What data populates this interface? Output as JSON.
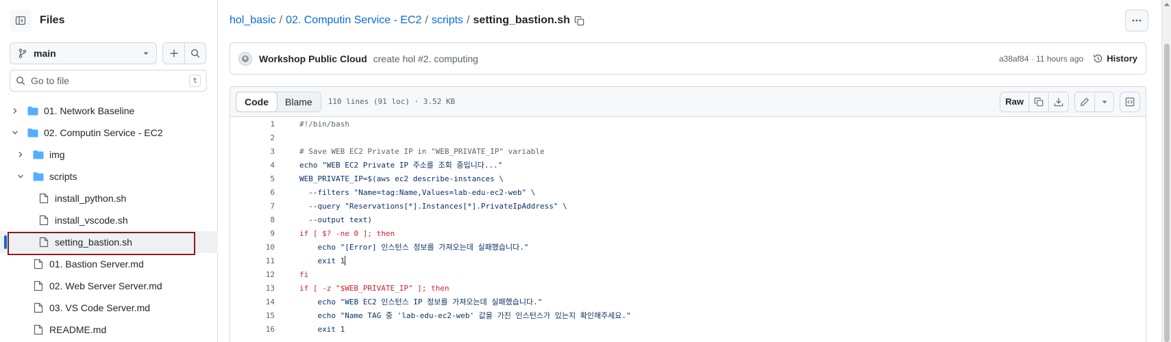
{
  "sidebar": {
    "title": "Files",
    "branch": "main",
    "goto_placeholder": "Go to file",
    "goto_shortcut": "t",
    "tree": [
      {
        "label": "01. Network Baseline",
        "kind": "folder",
        "expanded": false,
        "depth": 0
      },
      {
        "label": "02. Computin Service - EC2",
        "kind": "folder",
        "expanded": true,
        "depth": 0
      },
      {
        "label": "img",
        "kind": "folder",
        "expanded": false,
        "depth": 1
      },
      {
        "label": "scripts",
        "kind": "folder",
        "expanded": true,
        "depth": 1
      },
      {
        "label": "install_python.sh",
        "kind": "file",
        "depth": 2
      },
      {
        "label": "install_vscode.sh",
        "kind": "file",
        "depth": 2
      },
      {
        "label": "setting_bastion.sh",
        "kind": "file",
        "depth": 2,
        "selected": true
      },
      {
        "label": "01. Bastion Server.md",
        "kind": "file",
        "depth": 1
      },
      {
        "label": "02. Web Server Server.md",
        "kind": "file",
        "depth": 1
      },
      {
        "label": "03. VS Code Server.md",
        "kind": "file",
        "depth": 1
      },
      {
        "label": "README.md",
        "kind": "file",
        "depth": 1
      }
    ]
  },
  "breadcrumb": {
    "repo": "hol_basic",
    "dir1": "02. Computin Service - EC2",
    "dir2": "scripts",
    "file": "setting_bastion.sh"
  },
  "commit": {
    "author": "Workshop Public Cloud",
    "message": "create hol #2. computing",
    "meta": "a38af84 · 11 hours ago",
    "history_label": "History"
  },
  "file_header": {
    "tab_code": "Code",
    "tab_blame": "Blame",
    "info": "110 lines (91 loc) · 3.52 KB",
    "raw_label": "Raw"
  },
  "code_lines": [
    {
      "n": "1",
      "text": "#!/bin/bash"
    },
    {
      "n": "2",
      "text": ""
    },
    {
      "n": "3",
      "text": "# Save WEB EC2 Private IP in \"WEB_PRIVATE_IP\" variable"
    },
    {
      "n": "4",
      "text": "echo \"WEB EC2 Private IP 주소를 조회 중입니다...\""
    },
    {
      "n": "5",
      "text": "WEB_PRIVATE_IP=$(aws ec2 describe-instances \\"
    },
    {
      "n": "6",
      "text": "  --filters \"Name=tag:Name,Values=lab-edu-ec2-web\" \\"
    },
    {
      "n": "7",
      "text": "  --query \"Reservations[*].Instances[*].PrivateIpAddress\" \\"
    },
    {
      "n": "8",
      "text": "  --output text)"
    },
    {
      "n": "9",
      "text": "if [ $? -ne 0 ]; then"
    },
    {
      "n": "10",
      "text": "    echo \"[Error] 인스턴스 정보를 가져오는데 실패했습니다.\""
    },
    {
      "n": "11",
      "text": "    exit 1"
    },
    {
      "n": "12",
      "text": "fi"
    },
    {
      "n": "13",
      "text": "if [ -z \"$WEB_PRIVATE_IP\" ]; then"
    },
    {
      "n": "14",
      "text": "    echo \"WEB EC2 인스턴스 IP 정보를 가져오는데 실패했습니다.\""
    },
    {
      "n": "15",
      "text": "    echo \"Name TAG 중 'lab-edu-ec2-web' 값을 가진 인스턴스가 있는지 확인해주세요.\""
    },
    {
      "n": "16",
      "text": "    exit 1"
    }
  ],
  "colors": {
    "link": "#0969da",
    "muted": "#59636e",
    "border": "#d1d9e0",
    "selection_outline": "#8b1a1f"
  }
}
